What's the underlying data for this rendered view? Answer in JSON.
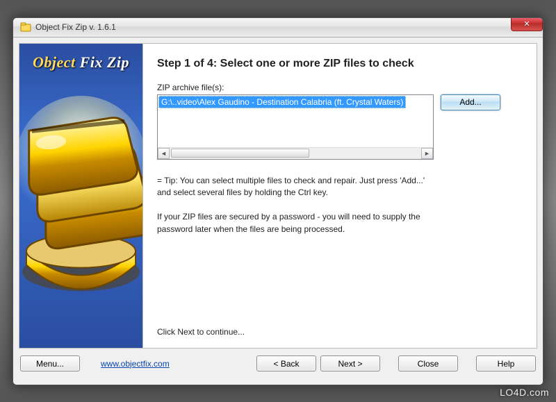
{
  "window": {
    "title": "Object Fix Zip v. 1.6.1",
    "close_glyph": "✕"
  },
  "sidebar": {
    "brand_word1": "Object",
    "brand_word2": "Fix Zip"
  },
  "wizard": {
    "heading": "Step 1 of 4: Select one or more ZIP files to check",
    "label_archive": "ZIP archive file(s):",
    "files": [
      "G:\\..video\\Alex Gaudino - Destination Calabria (ft. Crystal Waters)"
    ],
    "add_label": "Add...",
    "tip": "= Tip: You can select multiple files to check and repair. Just press 'Add...' and select several files by holding the Ctrl key.",
    "password_note": "If your ZIP files are secured by a password - you will need to supply the password later when the files are being processed.",
    "continue": "Click Next to continue..."
  },
  "footer": {
    "menu": "Menu...",
    "url": "www.objectfix.com",
    "back": "< Back",
    "next": "Next >",
    "close": "Close",
    "help": "Help"
  },
  "watermark": "LO4D.com"
}
